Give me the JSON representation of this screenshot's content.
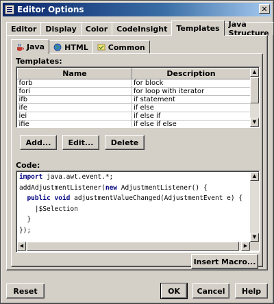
{
  "window": {
    "title": "Editor Options",
    "close_glyph": "✕"
  },
  "tabs": [
    {
      "label": "Editor"
    },
    {
      "label": "Display"
    },
    {
      "label": "Color"
    },
    {
      "label": "CodeInsight"
    },
    {
      "label": "Templates"
    },
    {
      "label": "Java Structure"
    }
  ],
  "active_tab": "Templates",
  "subtabs": [
    {
      "label": "Java",
      "icon": "java-cup-icon"
    },
    {
      "label": "HTML",
      "icon": "globe-icon"
    },
    {
      "label": "Common",
      "icon": "common-icon"
    }
  ],
  "templates": {
    "label": "Templates:",
    "columns": [
      "Name",
      "Description"
    ],
    "rows": [
      {
        "name": "forb",
        "description": "for block"
      },
      {
        "name": "fori",
        "description": "for loop with iterator"
      },
      {
        "name": "ifb",
        "description": "if statement"
      },
      {
        "name": "ife",
        "description": "if else"
      },
      {
        "name": "iei",
        "description": "if else if"
      },
      {
        "name": "ifie",
        "description": "if else if else"
      }
    ]
  },
  "buttons": {
    "add": "Add...",
    "edit": "Edit...",
    "delete": "Delete",
    "insert_macro": "Insert Macro...",
    "reset": "Reset",
    "ok": "OK",
    "cancel": "Cancel",
    "help": "Help"
  },
  "code": {
    "label": "Code:",
    "lines": [
      "import java.awt.event.*;",
      "addAdjustmentListener(new AdjustmentListener() {",
      "  public void adjustmentValueChanged(AdjustmentEvent e) {",
      "    |$Selection",
      "  }",
      "});"
    ]
  },
  "colors": {
    "title_gradient_start": "#0a246a",
    "keyword": "#000080",
    "face": "#d4d0c8"
  }
}
